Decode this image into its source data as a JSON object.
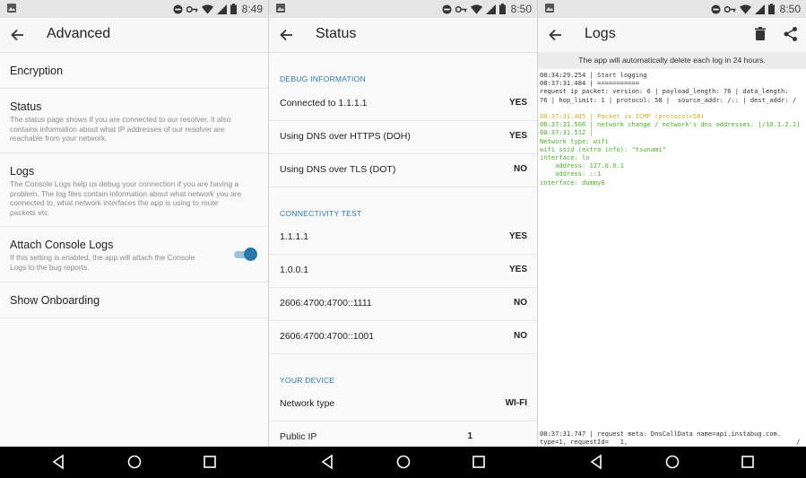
{
  "colors": {
    "accent": "#2b78b0",
    "log_green": "#4bb22a",
    "log_yellow": "#c9b02a"
  },
  "screens": [
    {
      "status_time": "8:49",
      "title": "Advanced",
      "items": [
        {
          "title": "Encryption",
          "desc": ""
        },
        {
          "title": "Status",
          "desc": "The status page shows if you are connected to our resolver. It also contains information about what IP addresses of our resolver are reachable from your network."
        },
        {
          "title": "Logs",
          "desc": "The Console Logs help us debug your connection if you are having a problem. The log files contain information about what network you are connected to, what network interfaces the app is using to route packets etc."
        },
        {
          "title": "Attach Console Logs",
          "desc": "If this setting is enabled, the app will attach the Console Logs to the bug reports.",
          "toggle_on": true
        },
        {
          "title": "Show Onboarding",
          "desc": ""
        }
      ]
    },
    {
      "status_time": "8:50",
      "title": "Status",
      "sections": [
        {
          "header": "DEBUG INFORMATION",
          "rows": [
            {
              "label": "Connected to 1.1.1.1",
              "value": "YES"
            },
            {
              "label": "Using DNS over HTTPS (DOH)",
              "value": "YES"
            },
            {
              "label": "Using DNS over TLS (DOT)",
              "value": "NO"
            }
          ]
        },
        {
          "header": "CONNECTIVITY TEST",
          "rows": [
            {
              "label": "1.1.1.1",
              "value": "YES"
            },
            {
              "label": "1.0.0.1",
              "value": "YES"
            },
            {
              "label": "2606:4700:4700::1111",
              "value": "NO"
            },
            {
              "label": "2606:4700:4700::1001",
              "value": "NO"
            }
          ]
        },
        {
          "header": "YOUR DEVICE",
          "rows": [
            {
              "label": "Network type",
              "value": "WI-FI"
            },
            {
              "label": "Public IP",
              "value": "1"
            }
          ]
        }
      ]
    },
    {
      "status_time": "8:50",
      "title": "Logs",
      "banner": "The app will automatically delete each log in 24 hours.",
      "log_top": [
        {
          "text": "08:34:29.254 | Start logging",
          "color": "default"
        },
        {
          "text": "08:37:31.484 | ===========",
          "color": "default"
        },
        {
          "text": "request ip packet: version: 6 | payload_length: 76 | data_length:",
          "color": "default"
        },
        {
          "text": "76 | hop_limit: 1 | protocol: 58 |  source_addr: /:: | dest_addr: /",
          "color": "default"
        },
        {
          "text": "",
          "color": "default"
        },
        {
          "text": "08:37:31.485 | Packet is ICMP (protocol=58)",
          "color": "yellow"
        },
        {
          "text": "08:37:31.506 | network change / network's dns addresses: [/10.1.2.1]",
          "color": "green"
        },
        {
          "text": "08:37:31.512 |",
          "color": "green"
        },
        {
          "text": "Network type: wifi",
          "color": "green"
        },
        {
          "text": "wifi ssid (extra info): \"tsunami\"",
          "color": "green"
        },
        {
          "text": "interface: lo",
          "color": "green"
        },
        {
          "text": "    address: 127.0.0.1",
          "color": "green"
        },
        {
          "text": "    address: ::1",
          "color": "green"
        },
        {
          "text": "interface: dummy0",
          "color": "green"
        }
      ],
      "log_bottom": [
        {
          "text": "08:37:31.747 | request meta: DnsCallData name=api.instabug.com.",
          "color": "default"
        },
        {
          "text": "type=1, requestId=   1,                                            /",
          "color": "default"
        }
      ]
    }
  ]
}
